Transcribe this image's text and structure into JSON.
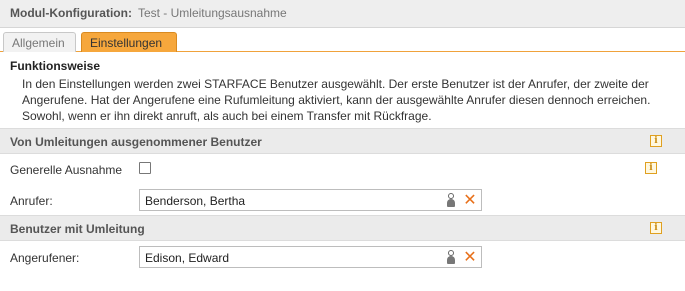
{
  "header": {
    "label": "Modul-Konfiguration:",
    "value": "Test - Umleitungsausnahme"
  },
  "tabs": [
    {
      "label": "Allgemein",
      "active": false
    },
    {
      "label": "Einstellungen",
      "active": true
    }
  ],
  "functionality": {
    "title": "Funktionsweise",
    "text": "In den Einstellungen werden zwei STARFACE Benutzer ausgewählt. Der erste Benutzer ist der Anrufer, der zweite der Angerufene. Hat der Angerufene eine Rufumleitung aktiviert, kann der ausgewählte Anrufer diesen dennoch erreichen. Sowohl, wenn er ihn direkt anruft, als auch bei einem Transfer mit Rückfrage."
  },
  "group_excluded": {
    "title": "Von Umleitungen ausgenommener Benutzer",
    "general_exception_label": "Generelle Ausnahme",
    "general_exception_checked": false,
    "caller_label": "Anrufer:",
    "caller_value": "Benderson, Bertha"
  },
  "group_forwarding": {
    "title": "Benutzer mit Umleitung",
    "callee_label": "Angerufener:",
    "callee_value": "Edison, Edward"
  },
  "icons": {
    "info": "info-icon",
    "user": "user-icon",
    "clear": "close-icon"
  },
  "colors": {
    "accent": "#f6a73c",
    "clear_icon": "#e8701a",
    "info_border": "#e0a020"
  }
}
